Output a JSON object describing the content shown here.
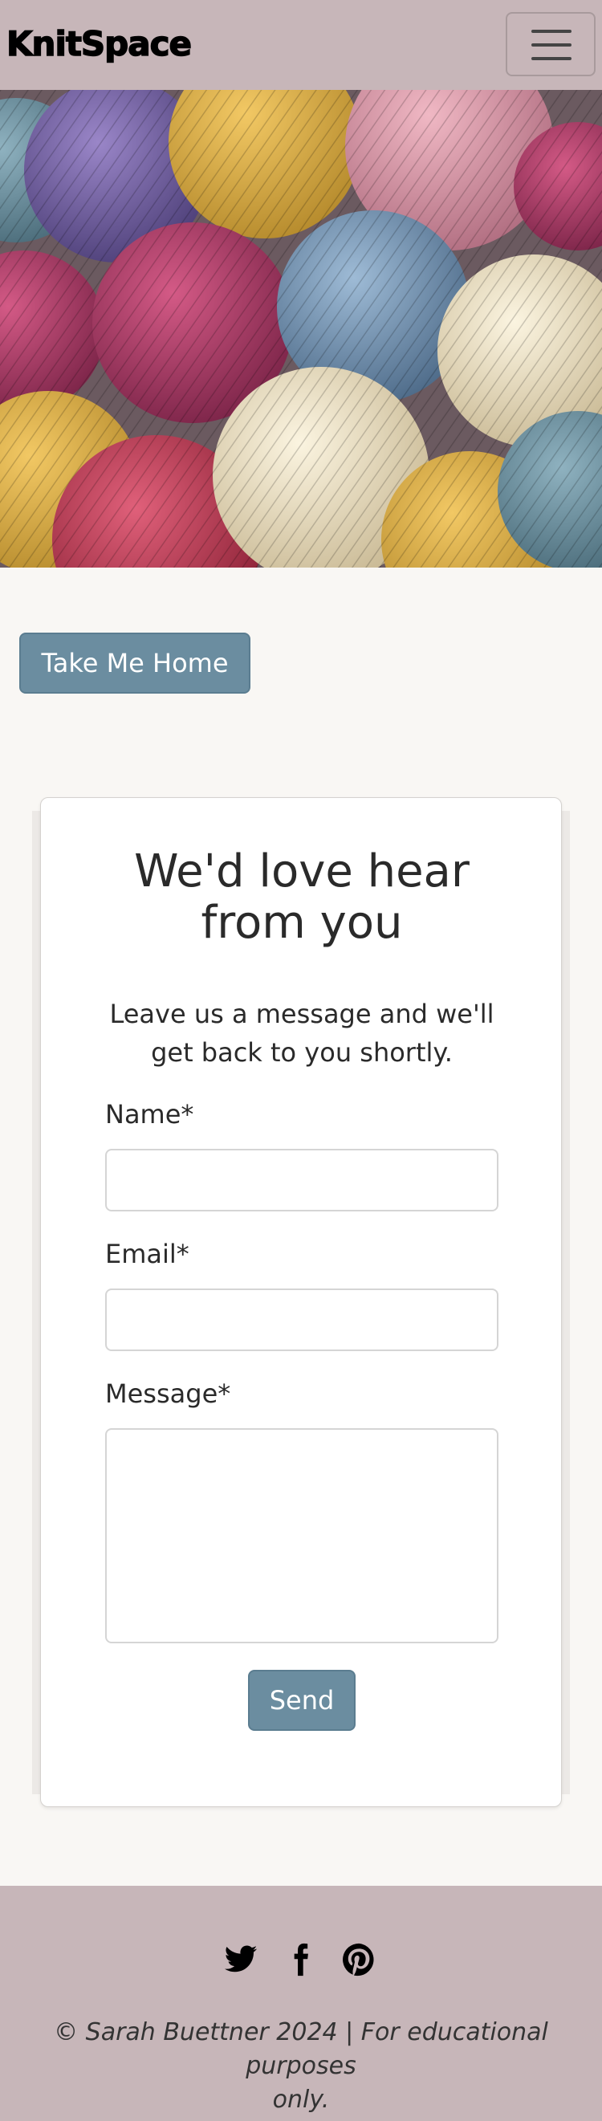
{
  "navbar": {
    "brand": "KnitSpace",
    "toggle_icon": "hamburger-menu-icon"
  },
  "hero": {
    "image_description_icon": "yarn-balls-image"
  },
  "home_button": {
    "label": "Take Me Home"
  },
  "contact": {
    "title_line1": "We'd love hear",
    "title_line2": "from you",
    "lead_line1": "Leave us a message and we'll",
    "lead_line2": "get back to you shortly.",
    "name_label": "Name*",
    "name_value": "",
    "email_label": "Email*",
    "email_value": "",
    "message_label": "Message*",
    "message_value": "",
    "send_label": "Send"
  },
  "footer": {
    "social_icons": [
      "twitter-icon",
      "facebook-icon",
      "pinterest-icon"
    ],
    "copyright_line1": "© Sarah Buettner 2024 | For educational purposes",
    "copyright_line2": "only."
  },
  "colors": {
    "navbar_bg": "#c7b6b9",
    "page_bg": "#f9f7f4",
    "button_bg": "#6b8da0"
  }
}
